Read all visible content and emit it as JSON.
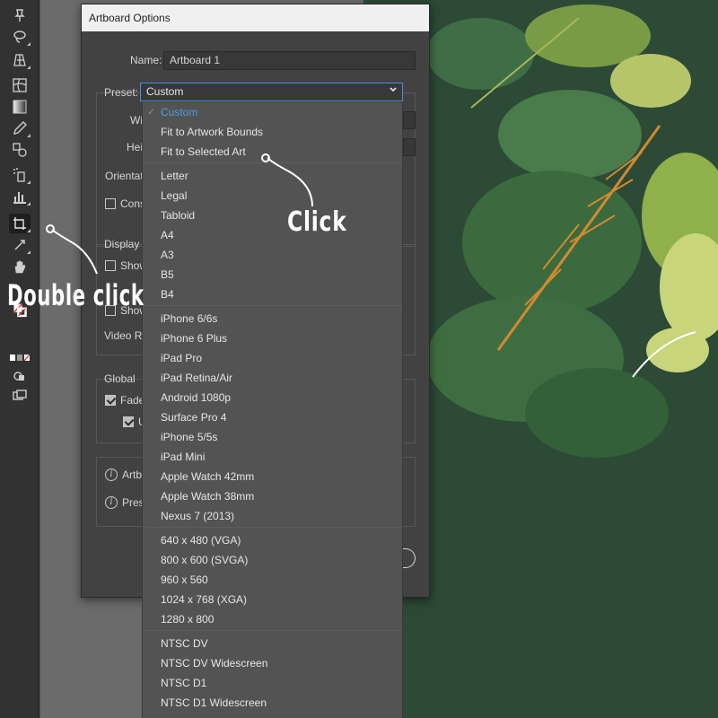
{
  "dialog": {
    "title": "Artboard Options",
    "name_label": "Name:",
    "name_value": "Artboard 1",
    "preset_label": "Preset:",
    "preset_value": "Custom",
    "width_label_partial": "Wi",
    "height_label_partial": "Hei",
    "orientation_label_partial": "Orientat",
    "constrain_label_partial": "Cons",
    "display_label": "Display",
    "show_label_1": "Show",
    "show_label_3": "Show",
    "video_ruler_partial": "Video R",
    "global_label": "Global",
    "fade_label_partial": "Fade",
    "update_label_partial": "U",
    "info_artboards_partial": "Artb",
    "info_presets_partial": "Pres"
  },
  "preset_menu": {
    "groups": [
      {
        "items": [
          {
            "label": "Custom",
            "selected": true
          },
          {
            "label": "Fit to Artwork Bounds"
          },
          {
            "label": "Fit to Selected Art"
          }
        ]
      },
      {
        "items": [
          {
            "label": "Letter"
          },
          {
            "label": "Legal"
          },
          {
            "label": "Tabloid"
          },
          {
            "label": "A4"
          },
          {
            "label": "A3"
          },
          {
            "label": "B5"
          },
          {
            "label": "B4"
          }
        ]
      },
      {
        "items": [
          {
            "label": "iPhone 6/6s"
          },
          {
            "label": "iPhone 6 Plus"
          },
          {
            "label": "iPad Pro"
          },
          {
            "label": "iPad Retina/Air"
          },
          {
            "label": "Android 1080p"
          },
          {
            "label": "Surface Pro 4"
          },
          {
            "label": "iPhone 5/5s"
          },
          {
            "label": "iPad Mini"
          },
          {
            "label": "Apple Watch 42mm"
          },
          {
            "label": "Apple Watch 38mm"
          },
          {
            "label": "Nexus 7 (2013)"
          }
        ]
      },
      {
        "items": [
          {
            "label": "640 x 480 (VGA)"
          },
          {
            "label": "800 x 600 (SVGA)"
          },
          {
            "label": "960 x 560"
          },
          {
            "label": "1024 x 768 (XGA)"
          },
          {
            "label": "1280 x 800"
          }
        ]
      },
      {
        "items": [
          {
            "label": "NTSC DV"
          },
          {
            "label": "NTSC DV Widescreen"
          },
          {
            "label": "NTSC D1"
          },
          {
            "label": "NTSC D1 Widescreen"
          }
        ]
      }
    ]
  },
  "annotations": {
    "click": "Click",
    "double_click": "Double click"
  },
  "tools": [
    "pin-icon",
    "lasso-icon",
    "perspective-grid-icon",
    "mesh-icon",
    "gradient-icon",
    "eyedropper-icon",
    "blend-icon",
    "symbol-sprayer-icon",
    "column-graph-icon",
    "artboard-tool-icon",
    "slice-icon",
    "hand-icon",
    "zoom-icon",
    "fill-stroke-icon",
    "color-mode-icon",
    "draw-mode-icon",
    "screen-mode-icon"
  ],
  "colors": {
    "accent": "#4a9be8",
    "dialog_bg": "#424242",
    "menu_bg": "#535353",
    "art_bg": "#2c4a36"
  }
}
